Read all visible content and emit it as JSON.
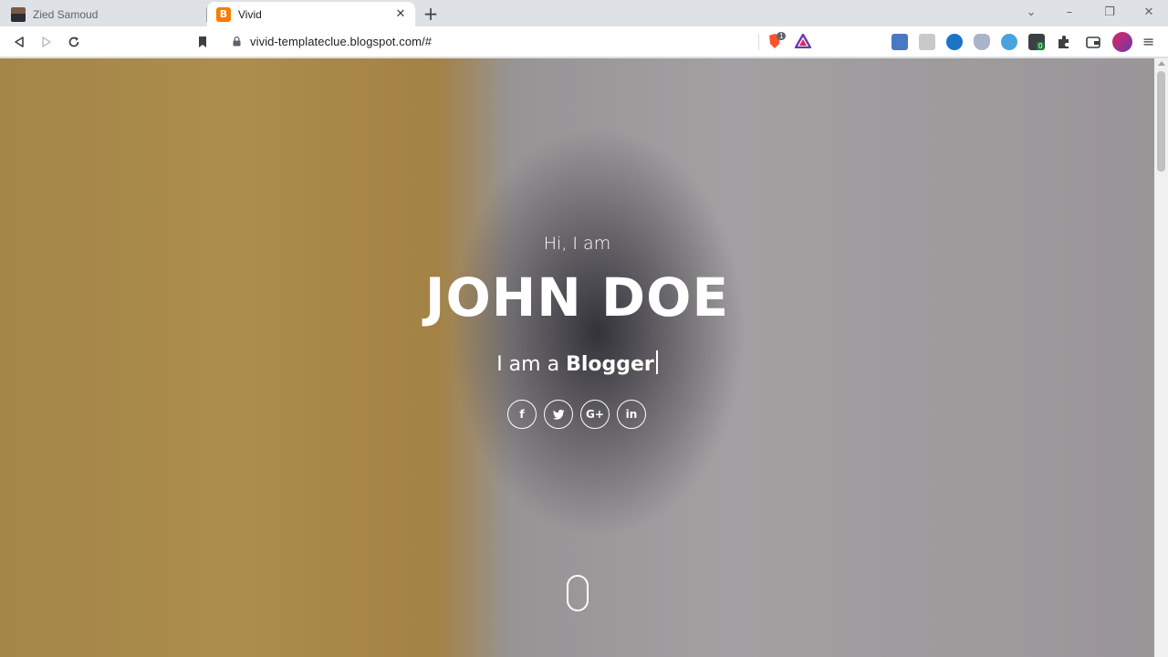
{
  "browser": {
    "tabs": [
      {
        "title": "Zied Samoud",
        "active": false
      },
      {
        "title": "Vivid",
        "active": true
      }
    ],
    "url": "vivid-templateclue.blogspot.com/#",
    "shields_count": "1",
    "extension_badge": "0"
  },
  "hero": {
    "greeting": "Hi, I am",
    "name": "JOHN DOE",
    "tagline_prefix": "I am a ",
    "tagline_role": "Blogger",
    "socials": [
      {
        "icon": "facebook-icon",
        "glyph": "f"
      },
      {
        "icon": "twitter-icon",
        "glyph": "t"
      },
      {
        "icon": "google-plus-icon",
        "glyph": "G+"
      },
      {
        "icon": "linkedin-icon",
        "glyph": "in"
      }
    ]
  },
  "colors": {
    "brave_orange": "#fb542b",
    "blogger_orange": "#f57d00",
    "wall_yellow": "#d3ad5e",
    "wall_grey": "#c8c3c6"
  }
}
